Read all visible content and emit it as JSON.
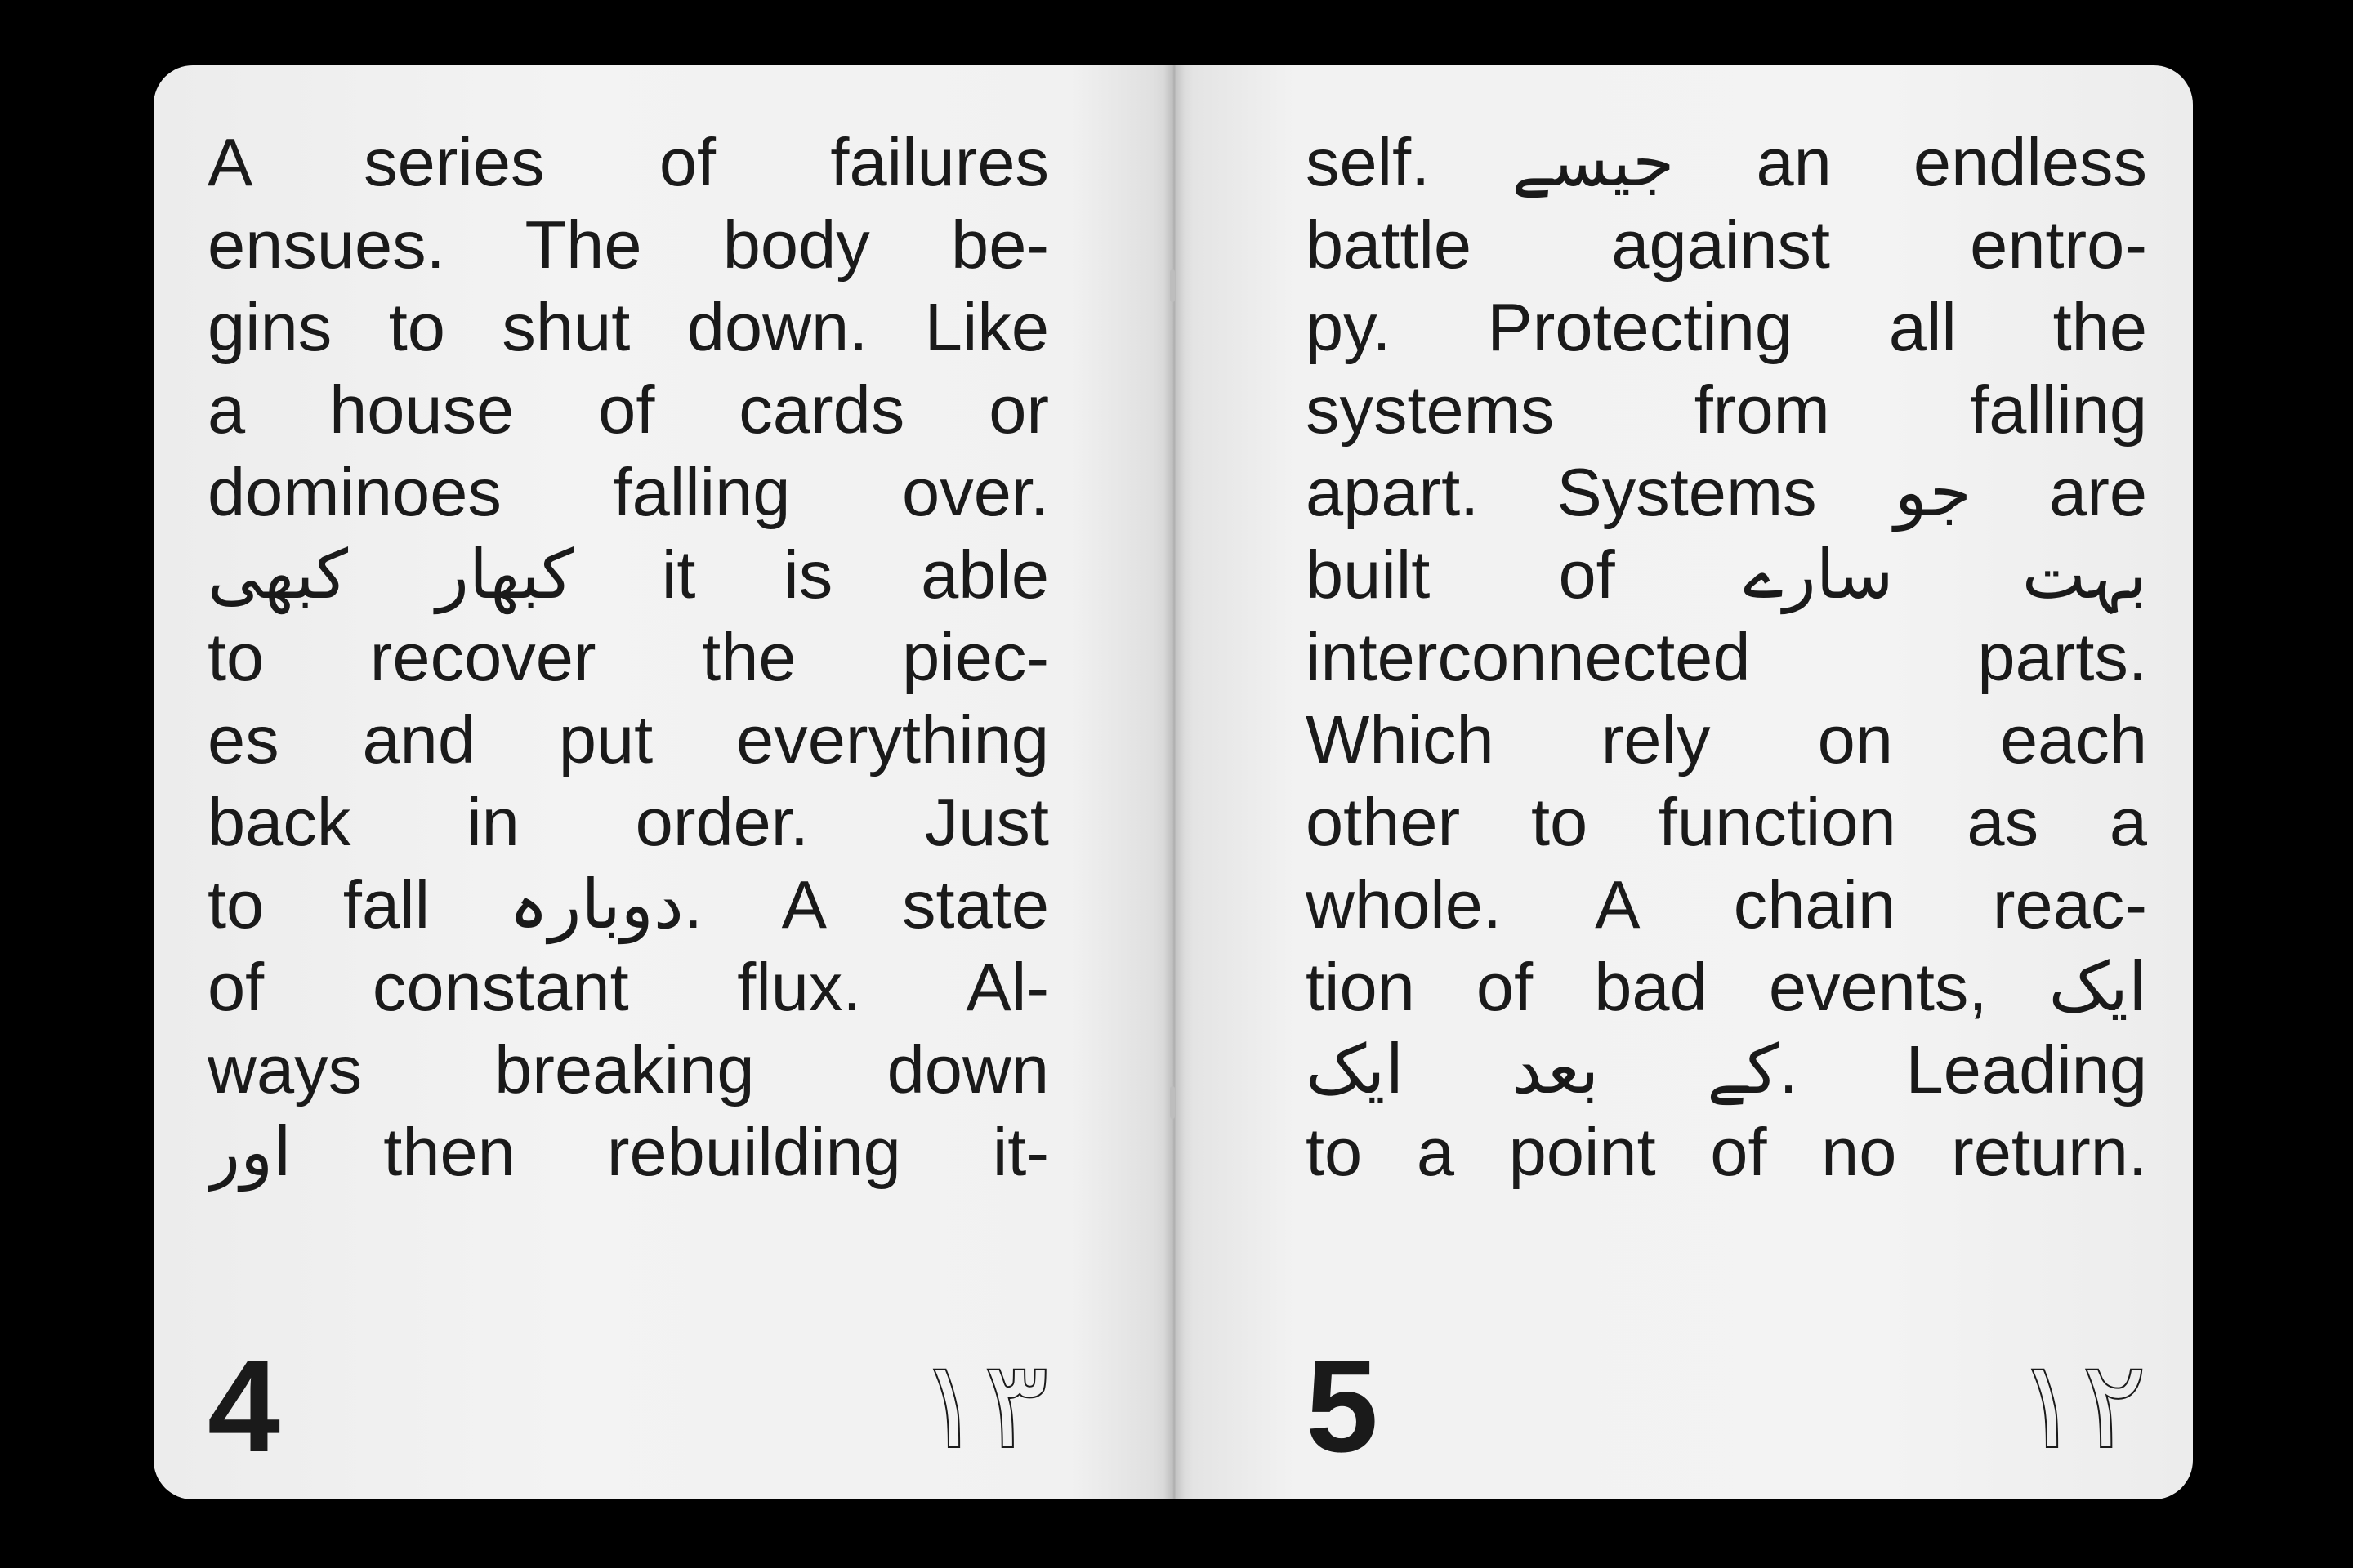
{
  "left_page": {
    "lines": [
      "A series of failures",
      "ensues. The body be-",
      "gins to shut down. Like",
      "a house of cards or",
      "dominoes falling over.",
      "کبھار کبھی it is able",
      "to recover the piec-",
      "es and put everything",
      "back in order. Just",
      "to fall دوبارہ. A state",
      "of constant flux. Al-",
      "ways breaking down",
      "اور then rebuilding it-"
    ],
    "page_number": "4",
    "page_number_urdu": "۱۳"
  },
  "right_page": {
    "lines": [
      "self. جیسے an endless",
      "battle against entro-",
      "py. Protecting all the",
      "systems from falling",
      "apart. Systems جو are",
      "built of بہت سارے",
      "interconnected parts.",
      "Which rely on each",
      "other to function as a",
      "whole. A chain reac-",
      "tion of bad events, ایک",
      "کے بعد ایک. Leading",
      "to a point of no return."
    ],
    "page_number": "5",
    "page_number_urdu": "۱۲"
  },
  "colors": {
    "background": "#000000",
    "paper": "#f2f2f2",
    "ink": "#1a1a1a"
  }
}
